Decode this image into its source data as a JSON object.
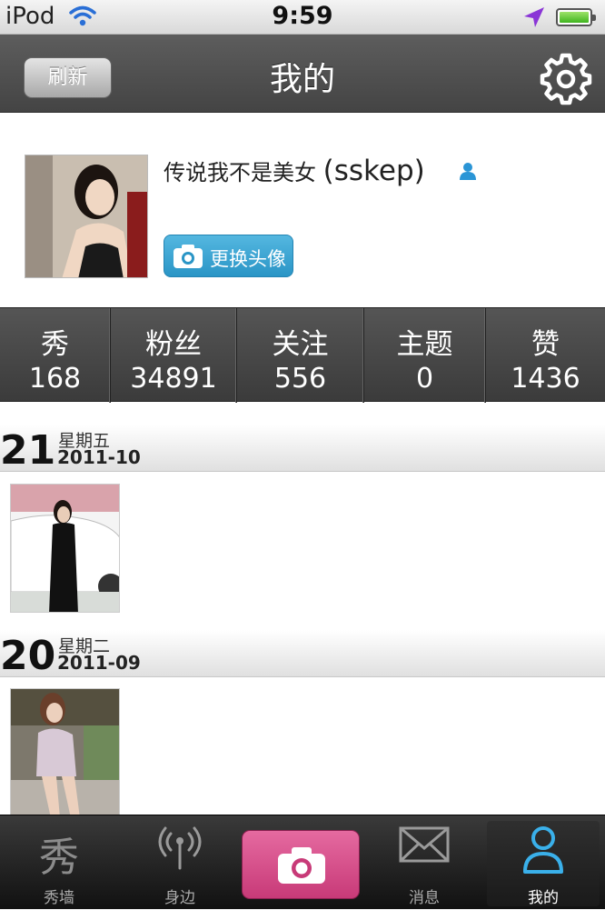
{
  "status_bar": {
    "device": "iPod",
    "time": "9:59",
    "wifi_icon": "wifi-icon",
    "location_icon": "location-arrow-icon",
    "battery_level": 0.9,
    "battery_color": "#3fb41e"
  },
  "nav": {
    "refresh_label": "刷新",
    "title": "我的",
    "settings_icon": "gear-icon"
  },
  "profile": {
    "name": "传说我不是美女",
    "handle": "(sskep)",
    "change_avatar_label": "更换头像",
    "accent_color": "#2a95c6"
  },
  "stats": [
    {
      "label": "秀",
      "value": "168"
    },
    {
      "label": "粉丝",
      "value": "34891"
    },
    {
      "label": "关注",
      "value": "556"
    },
    {
      "label": "主题",
      "value": "0"
    },
    {
      "label": "赞",
      "value": "1436"
    }
  ],
  "feed": [
    {
      "day": "21",
      "weekday": "星期五",
      "month": "2011-10"
    },
    {
      "day": "20",
      "weekday": "星期二",
      "month": "2011-09"
    }
  ],
  "tabbar": {
    "wall_label": "秀墙",
    "wall_icon_text": "秀",
    "nearby_label": "身边",
    "camera_icon": "camera-icon",
    "messages_label": "消息",
    "me_label": "我的",
    "me_active": true,
    "camera_color": "#d44d88"
  }
}
